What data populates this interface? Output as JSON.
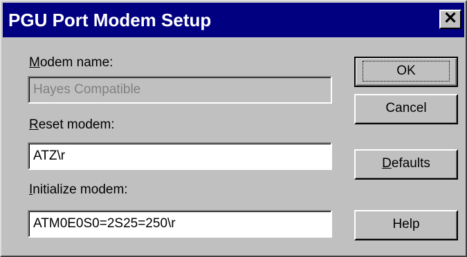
{
  "window": {
    "title": "PGU Port Modem Setup",
    "close_glyph": "✕"
  },
  "fields": {
    "modem_name": {
      "label_accel": "M",
      "label_rest": "odem name:",
      "value": "Hayes Compatible"
    },
    "reset_modem": {
      "label_accel": "R",
      "label_rest": "eset modem:",
      "value": "ATZ\\r"
    },
    "initialize_modem": {
      "label_accel": "I",
      "label_rest": "nitialize modem:",
      "value": "ATM0E0S0=2S25=250\\r"
    }
  },
  "buttons": {
    "ok": "OK",
    "cancel": "Cancel",
    "defaults_accel": "D",
    "defaults_rest": "efaults",
    "help": "Help"
  }
}
